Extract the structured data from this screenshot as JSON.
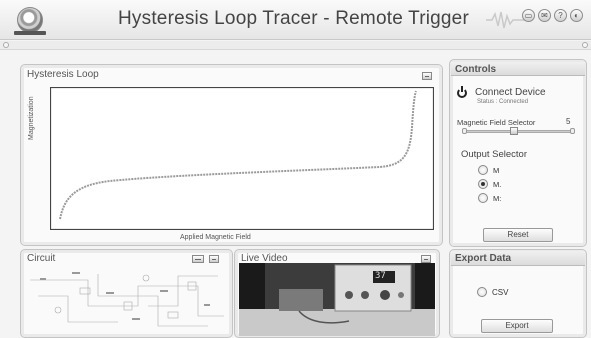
{
  "header": {
    "title": "Hysteresis Loop Tracer - Remote Trigger",
    "icons": [
      "minimize-window-icon",
      "chat-icon",
      "help-icon",
      "close-icon"
    ]
  },
  "hysteresis": {
    "title": "Hysteresis Loop",
    "ylabel": "Magnetization",
    "xlabel": "Applied Magnetic Field"
  },
  "controls": {
    "title": "Controls",
    "connect_label": "Connect Device",
    "status_text": "Status : Connected",
    "field_selector_label": "Magnetic Field Selector",
    "field_selector_value": "5",
    "output_selector_label": "Output Selector",
    "output_options": [
      "M",
      "M.",
      "M:"
    ],
    "selected_output": 1,
    "reset_label": "Reset"
  },
  "export": {
    "title": "Export Data",
    "csv_label": "CSV",
    "export_label": "Export"
  },
  "circuit": {
    "title": "Circuit"
  },
  "video": {
    "title": "Live Video",
    "meter_reading": "37"
  },
  "colors": {
    "accent": "#555555",
    "panel_bg": "#fafafa",
    "trace": "#9a9a9a"
  }
}
